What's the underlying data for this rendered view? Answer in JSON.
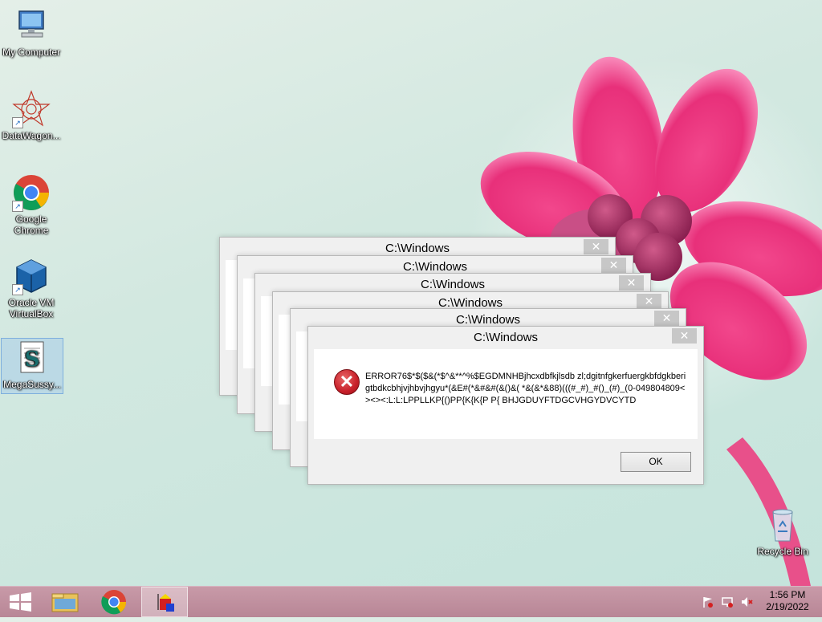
{
  "desktop": {
    "icons": [
      {
        "label": "My Computer"
      },
      {
        "label": "DataWagon..."
      },
      {
        "label": "Google Chrome"
      },
      {
        "label": "Oracle VM VirtualBox"
      },
      {
        "label": "MegaSussy..."
      },
      {
        "label": "Recycle Bin"
      }
    ]
  },
  "dialogs": [
    {
      "title": "C:\\Windows",
      "close_glyph": "✕"
    },
    {
      "title": "C:\\Windows",
      "close_glyph": "✕"
    },
    {
      "title": "C:\\Windows",
      "close_glyph": "✕"
    },
    {
      "title": "C:\\Windows",
      "close_glyph": "✕"
    },
    {
      "title": "C:\\Windows",
      "close_glyph": "✕"
    },
    {
      "title": "C:\\Windows",
      "close_glyph": "✕",
      "message": "ERROR76$*$($&(*$^&**^%$EGDMNHBjhcxdbfkjlsdb zl;dgitnfgkerfuergkbfdgkberigtbdkcbhjvjhbvjhgyu*(&E#(*&#&#(&()&( *&(&*&88)(((#_#)_#()_(#)_(0-049804809<><><:L:L:LPPLLKP{()PP{K{K{P P{ BHJGDUYFTDGCVHGYDVCYTD",
      "ok_label": "OK",
      "icon": "error-icon"
    }
  ],
  "taskbar": {
    "items": [
      "start-button",
      "file-explorer",
      "google-chrome",
      "megasussy-app"
    ],
    "time": "1:56 PM",
    "date": "2/19/2022"
  },
  "colors": {
    "taskbar": "#c89aa8",
    "flower": "#e8307a",
    "close_button": "#c7c7c7"
  }
}
